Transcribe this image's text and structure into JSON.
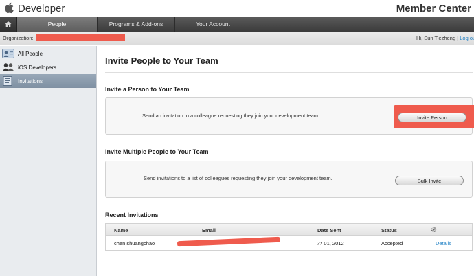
{
  "header": {
    "brand": "Developer",
    "section": "Member Center"
  },
  "nav": {
    "home_icon": "home-icon",
    "tabs": [
      {
        "label": "People"
      },
      {
        "label": "Programs & Add-ons"
      },
      {
        "label": "Your Account"
      }
    ]
  },
  "orgbar": {
    "label": "Organization:",
    "greeting": "Hi, Sun Tiezheng",
    "separator": " | ",
    "logout": "Log ou"
  },
  "sidebar": {
    "items": [
      {
        "label": "All People",
        "icon": "people-card-icon"
      },
      {
        "label": "iOS Developers",
        "icon": "group-icon"
      },
      {
        "label": "Invitations",
        "icon": "envelope-icon"
      }
    ]
  },
  "main": {
    "title": "Invite People to Your Team",
    "single": {
      "heading": "Invite a Person to Your Team",
      "description": "Send an invitation to a colleague requesting they join your development team.",
      "button": "Invite Person"
    },
    "multiple": {
      "heading": "Invite Multiple People to Your Team",
      "description": "Send invitations to a list of colleagues requesting they join your development team.",
      "button": "Bulk Invite"
    },
    "recent": {
      "heading": "Recent Invitations",
      "columns": [
        "Name",
        "Email",
        "Date Sent",
        "Status"
      ],
      "settings_icon": "gear-icon",
      "rows": [
        {
          "name": "chen shuangchao",
          "date": "?? 01, 2012",
          "status": "Accepted",
          "action": "Details"
        }
      ]
    }
  },
  "colors": {
    "redaction": "#ef5b4d",
    "link": "#1d7fc4",
    "nav_active": "#6e6e6e"
  }
}
